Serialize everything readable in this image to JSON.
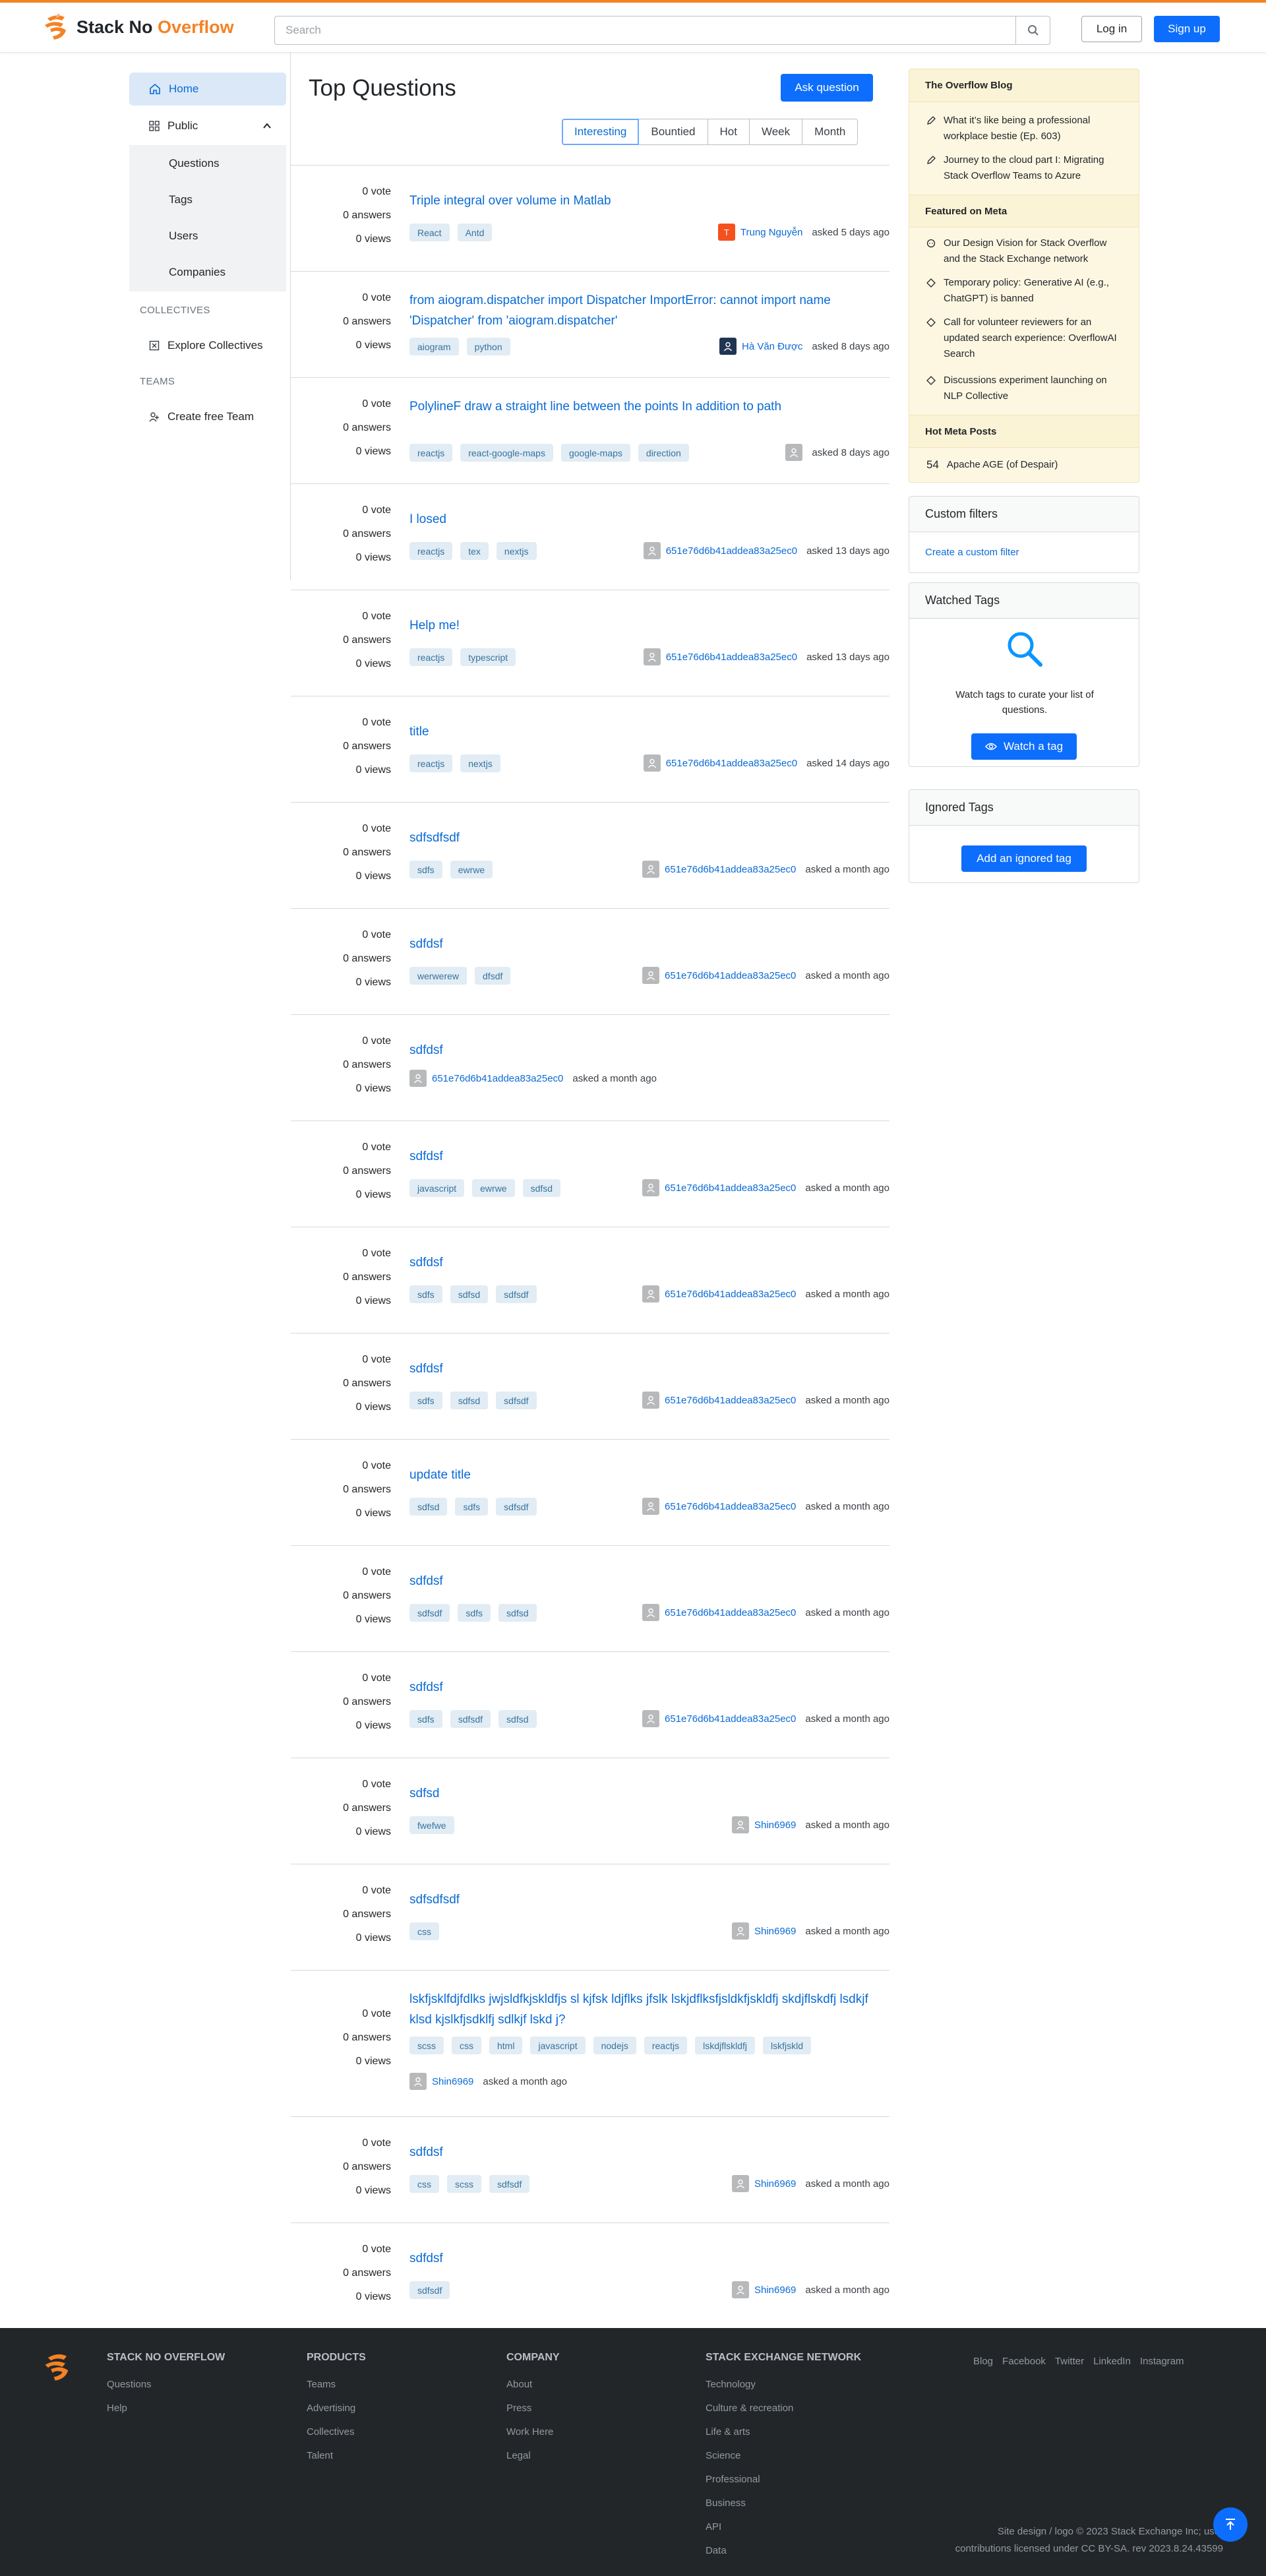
{
  "header": {
    "logo_text_a": "Stack No ",
    "logo_text_b": "Overflow",
    "search_placeholder": "Search",
    "login_label": "Log in",
    "signup_label": "Sign up"
  },
  "sidebar": {
    "home": "Home",
    "public": "Public",
    "public_items": [
      "Questions",
      "Tags",
      "Users",
      "Companies"
    ],
    "collectives_label": "COLLECTIVES",
    "explore_collectives": "Explore Collectives",
    "teams_label": "TEAMS",
    "create_team": "Create free Team"
  },
  "main": {
    "title": "Top Questions",
    "ask_button": "Ask question",
    "filters": [
      "Interesting",
      "Bountied",
      "Hot",
      "Week",
      "Month"
    ],
    "questions": [
      {
        "votes": "0 vote",
        "answers": "0 answers",
        "views": "0 views",
        "title": "Triple integral over volume in Matlab",
        "tags": [
          "React",
          "Antd"
        ],
        "user": "Trung Nguyễn",
        "avatar": "T",
        "avatar_color": "#f4511e",
        "when": "asked 5 days ago"
      },
      {
        "votes": "0 vote",
        "answers": "0 answers",
        "views": "0 views",
        "title": "from aiogram.dispatcher import Dispatcher ImportError: cannot import name 'Dispatcher' from 'aiogram.dispatcher'",
        "tags": [
          "aiogram",
          "python"
        ],
        "user": "Hà Văn Được",
        "avatar": "",
        "avatar_color": "#1f3552",
        "when": "asked 8 days ago"
      },
      {
        "votes": "0 vote",
        "answers": "0 answers",
        "views": "0 views",
        "title": "PolylineF draw a straight line between the points In addition to path",
        "tags": [
          "reactjs",
          "react-google-maps",
          "google-maps",
          "direction"
        ],
        "user": "",
        "avatar": "",
        "avatar_color": "#b7b9bb",
        "when": "asked 8 days ago"
      },
      {
        "votes": "0 vote",
        "answers": "0 answers",
        "views": "0 views",
        "title": "I losed",
        "tags": [
          "reactjs",
          "tex",
          "nextjs"
        ],
        "user": "651e76d6b41addea83a25ec0",
        "avatar": "",
        "avatar_color": "#b7b9bb",
        "when": "asked 13 days ago"
      },
      {
        "votes": "0 vote",
        "answers": "0 answers",
        "views": "0 views",
        "title": "Help me!",
        "tags": [
          "reactjs",
          "typescript"
        ],
        "user": "651e76d6b41addea83a25ec0",
        "avatar": "",
        "avatar_color": "#b7b9bb",
        "when": "asked 13 days ago"
      },
      {
        "votes": "0 vote",
        "answers": "0 answers",
        "views": "0 views",
        "title": "title",
        "tags": [
          "reactjs",
          "nextjs"
        ],
        "user": "651e76d6b41addea83a25ec0",
        "avatar": "",
        "avatar_color": "#b7b9bb",
        "when": "asked 14 days ago"
      },
      {
        "votes": "0 vote",
        "answers": "0 answers",
        "views": "0 views",
        "title": "sdfsdfsdf",
        "tags": [
          "sdfs",
          "ewrwe"
        ],
        "user": "651e76d6b41addea83a25ec0",
        "avatar": "",
        "avatar_color": "#b7b9bb",
        "when": "asked a month ago"
      },
      {
        "votes": "0 vote",
        "answers": "0 answers",
        "views": "0 views",
        "title": "sdfdsf",
        "tags": [
          "werwerew",
          "dfsdf"
        ],
        "user": "651e76d6b41addea83a25ec0",
        "avatar": "",
        "avatar_color": "#b7b9bb",
        "when": "asked a month ago"
      },
      {
        "votes": "0 vote",
        "answers": "0 answers",
        "views": "0 views",
        "title": "sdfdsf",
        "tags": [],
        "user": "651e76d6b41addea83a25ec0",
        "avatar": "",
        "avatar_color": "#b7b9bb",
        "when": "asked a month ago"
      },
      {
        "votes": "0 vote",
        "answers": "0 answers",
        "views": "0 views",
        "title": "sdfdsf",
        "tags": [
          "javascript",
          "ewrwe",
          "sdfsd"
        ],
        "user": "651e76d6b41addea83a25ec0",
        "avatar": "",
        "avatar_color": "#b7b9bb",
        "when": "asked a month ago"
      },
      {
        "votes": "0 vote",
        "answers": "0 answers",
        "views": "0 views",
        "title": "sdfdsf",
        "tags": [
          "sdfs",
          "sdfsd",
          "sdfsdf"
        ],
        "user": "651e76d6b41addea83a25ec0",
        "avatar": "",
        "avatar_color": "#b7b9bb",
        "when": "asked a month ago"
      },
      {
        "votes": "0 vote",
        "answers": "0 answers",
        "views": "0 views",
        "title": "sdfdsf",
        "tags": [
          "sdfs",
          "sdfsd",
          "sdfsdf"
        ],
        "user": "651e76d6b41addea83a25ec0",
        "avatar": "",
        "avatar_color": "#b7b9bb",
        "when": "asked a month ago"
      },
      {
        "votes": "0 vote",
        "answers": "0 answers",
        "views": "0 views",
        "title": "update title",
        "tags": [
          "sdfsd",
          "sdfs",
          "sdfsdf"
        ],
        "user": "651e76d6b41addea83a25ec0",
        "avatar": "",
        "avatar_color": "#b7b9bb",
        "when": "asked a month ago"
      },
      {
        "votes": "0 vote",
        "answers": "0 answers",
        "views": "0 views",
        "title": "sdfdsf",
        "tags": [
          "sdfsdf",
          "sdfs",
          "sdfsd"
        ],
        "user": "651e76d6b41addea83a25ec0",
        "avatar": "",
        "avatar_color": "#b7b9bb",
        "when": "asked a month ago"
      },
      {
        "votes": "0 vote",
        "answers": "0 answers",
        "views": "0 views",
        "title": "sdfdsf",
        "tags": [
          "sdfs",
          "sdfsdf",
          "sdfsd"
        ],
        "user": "651e76d6b41addea83a25ec0",
        "avatar": "",
        "avatar_color": "#b7b9bb",
        "when": "asked a month ago"
      },
      {
        "votes": "0 vote",
        "answers": "0 answers",
        "views": "0 views",
        "title": "sdfsd",
        "tags": [
          "fwefwe"
        ],
        "user": "Shin6969",
        "avatar": "",
        "avatar_color": "#b7b9bb",
        "when": "asked a month ago"
      },
      {
        "votes": "0 vote",
        "answers": "0 answers",
        "views": "0 views",
        "title": "sdfsdfsdf",
        "tags": [
          "css"
        ],
        "user": "Shin6969",
        "avatar": "",
        "avatar_color": "#b7b9bb",
        "when": "asked a month ago"
      },
      {
        "votes": "0 vote",
        "answers": "0 answers",
        "views": "0 views",
        "title": "lskfjsklfdjfdlks jwjsldfkjskldfjs sl kjfsk ldjflks jfslk lskjdflksfjsldkfjskldfj skdjflskdfj lsdkjf klsd kjslkfjsdklfj sdlkjf lskd j?",
        "tags": [
          "scss",
          "css",
          "html",
          "javascript",
          "nodejs",
          "reactjs",
          "lskdjflskldfj",
          "lskfjskld"
        ],
        "user": "Shin6969",
        "avatar": "",
        "avatar_color": "#b7b9bb",
        "when": "asked a month ago"
      },
      {
        "votes": "0 vote",
        "answers": "0 answers",
        "views": "0 views",
        "title": "sdfdsf",
        "tags": [
          "css",
          "scss",
          "sdfsdf"
        ],
        "user": "Shin6969",
        "avatar": "",
        "avatar_color": "#b7b9bb",
        "when": "asked a month ago"
      },
      {
        "votes": "0 vote",
        "answers": "0 answers",
        "views": "0 views",
        "title": "sdfdsf",
        "tags": [
          "sdfsdf"
        ],
        "user": "Shin6969",
        "avatar": "",
        "avatar_color": "#b7b9bb",
        "when": "asked a month ago"
      }
    ]
  },
  "right": {
    "blog_title": "The Overflow Blog",
    "blog_items": [
      "What it’s like being a professional workplace bestie (Ep. 603)",
      "Journey to the cloud part I: Migrating Stack Overflow Teams to Azure"
    ],
    "meta_title": "Featured on Meta",
    "meta_items": [
      "Our Design Vision for Stack Overflow and the Stack Exchange network",
      "Temporary policy: Generative AI (e.g., ChatGPT) is banned",
      "Call for volunteer reviewers for an updated search experience: OverflowAI Search",
      "Discussions experiment launching on NLP Collective"
    ],
    "hot_title": "Hot Meta Posts",
    "hot_count": "54",
    "hot_item": "Apache AGE (of Despair)",
    "custom_filters_title": "Custom filters",
    "custom_filter_link": "Create a custom filter",
    "watched_title": "Watched Tags",
    "watched_text": "Watch tags to curate your list of questions.",
    "watch_button": "Watch a tag",
    "ignored_title": "Ignored Tags",
    "ignored_button": "Add an ignored tag"
  },
  "footer": {
    "brand": "STACK NO OVERFLOW",
    "brand_links": [
      "Questions",
      "Help"
    ],
    "products_title": "PRODUCTS",
    "products": [
      "Teams",
      "Advertising",
      "Collectives",
      "Talent"
    ],
    "company_title": "COMPANY",
    "company": [
      "About",
      "Press",
      "Work Here",
      "Legal"
    ],
    "network_title": "STACK EXCHANGE NETWORK",
    "network": [
      "Technology",
      "Culture & recreation",
      "Life & arts",
      "Science",
      "Professional",
      "Business",
      "API",
      "Data"
    ],
    "social": [
      "Blog",
      "Facebook",
      "Twitter",
      "LinkedIn",
      "Instagram"
    ],
    "copyright_1": "Site design / logo © 2023 Stack Exchange Inc; user",
    "copyright_2": "contributions licensed under CC BY-SA. rev 2023.8.24.43599"
  }
}
